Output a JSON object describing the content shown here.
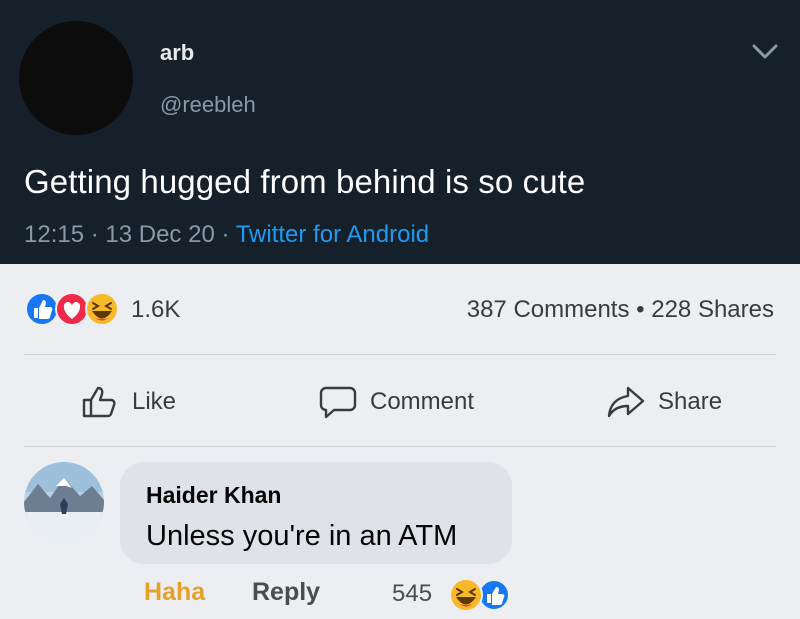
{
  "tweet": {
    "display_name": "arb",
    "handle": "@reebleh",
    "text": "Getting hugged from behind is so cute",
    "time": "12:15",
    "date": "13 Dec 20",
    "source": "Twitter for Android",
    "separator": " · "
  },
  "post": {
    "reaction_count": "1.6K",
    "reactions": [
      "like-icon",
      "love-icon",
      "haha-icon"
    ],
    "comments": "387 Comments",
    "stats_dot": " • ",
    "shares": "228 Shares",
    "actions": {
      "like": "Like",
      "comment": "Comment",
      "share": "Share"
    }
  },
  "comment": {
    "author": "Haider Khan",
    "text": "Unless you're in an ATM",
    "reaction_button": "Haha",
    "reply": "Reply",
    "reaction_count": "545",
    "reactions": [
      "haha-icon",
      "like-icon"
    ]
  },
  "colors": {
    "tweet_bg": "#15202b",
    "link_blue": "#1d9bf0",
    "page_bg": "#eceef1",
    "haha_orange": "#e5a228",
    "fb_blue": "#1877f2",
    "love_red": "#f02849"
  }
}
